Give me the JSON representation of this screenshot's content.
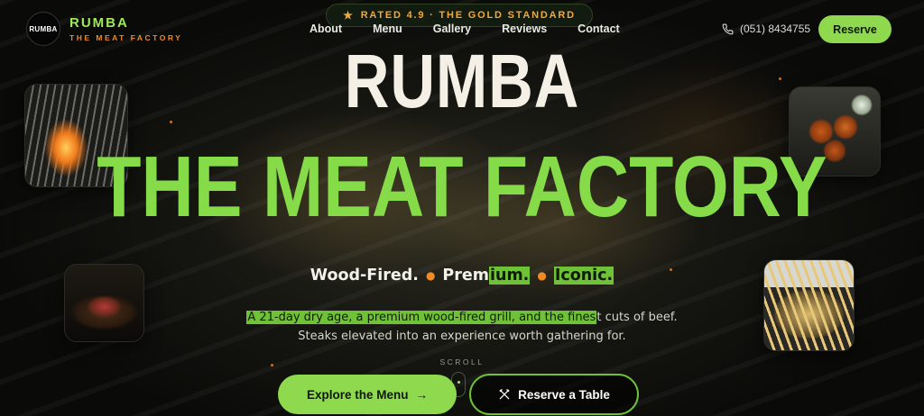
{
  "brand": {
    "badge": "RUMBA",
    "name": "RUMBA",
    "subtitle": "THE MEAT FACTORY"
  },
  "rating_badge": {
    "icon": "star-icon",
    "text": "RATED 4.9 · THE GOLD STANDARD"
  },
  "nav": {
    "links": [
      "About",
      "Menu",
      "Gallery",
      "Reviews",
      "Contact"
    ]
  },
  "contact": {
    "icon": "phone-icon",
    "phone": "(051) 8434755"
  },
  "header_cta": {
    "reserve_label": "Reserve"
  },
  "hero": {
    "title_line1": "RUMBA",
    "title_line2": "THE MEAT FACTORY",
    "tagline": {
      "part1": "Wood-Fired.",
      "part2_plain": "Prem",
      "part2_highlight": "ium.",
      "part3": "Iconic."
    },
    "description": {
      "highlight": "A 21-day dry age, a premium wood-fired grill, and the fines",
      "rest": "t cuts of beef. Steaks elevated into an experience worth gathering for."
    },
    "scroll_label": "SCROLL",
    "primary_cta": "Explore the Menu",
    "secondary_cta": "Reserve a Table"
  },
  "photos": [
    "grill-photo",
    "steak-photo",
    "wings-photo",
    "fries-photo"
  ],
  "colors": {
    "accent_green": "#8ed94e",
    "accent_orange": "#f08a24",
    "gold": "#f0a93a",
    "background": "#141410"
  }
}
